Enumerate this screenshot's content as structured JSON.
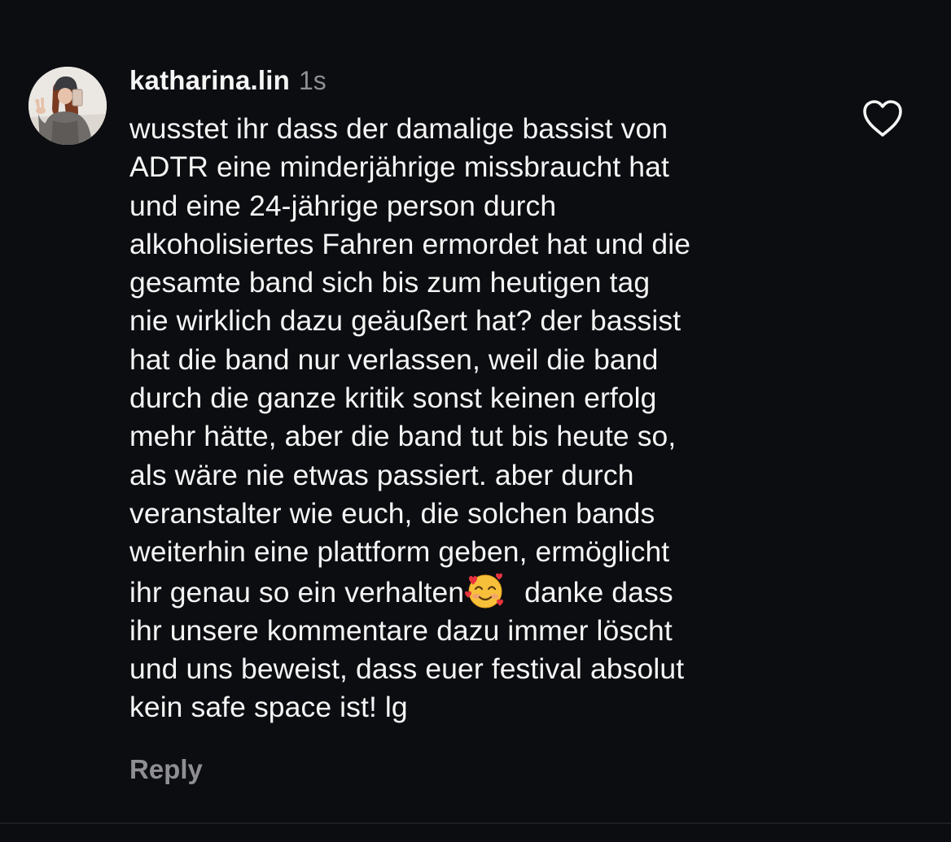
{
  "comment": {
    "username": "katharina.lin",
    "timestamp": "1s",
    "body_lines": [
      "wusstet ihr dass der damalige bassist von",
      "ADTR eine minderjährige missbraucht hat",
      "und eine 24-jährige person durch",
      "alkoholisiertes Fahren ermordet hat und die",
      "gesamte band sich bis zum heutigen tag",
      "nie wirklich dazu geäußert hat? der bassist",
      "hat die band nur verlassen, weil die band",
      "durch die ganze kritik sonst keinen erfolg",
      "mehr hätte, aber die band tut bis heute so,",
      "als wäre nie etwas passiert. aber durch",
      "veranstalter wie euch, die solchen bands",
      "weiterhin eine plattform geben, ermöglicht",
      "ihr genau so ein verhalten",
      " danke dass",
      "ihr unsere kommentare dazu immer löscht",
      "und uns beweist, dass euer festival absolut",
      "kein safe space ist! lg"
    ],
    "emoji": "smiling-face-with-hearts-icon",
    "reply_label": "Reply",
    "like_icon": "heart-outline-icon"
  },
  "colors": {
    "background": "#0c0d11",
    "text_primary": "#f5f5f5",
    "text_secondary": "#8e8e93",
    "divider": "#1d1e23"
  }
}
